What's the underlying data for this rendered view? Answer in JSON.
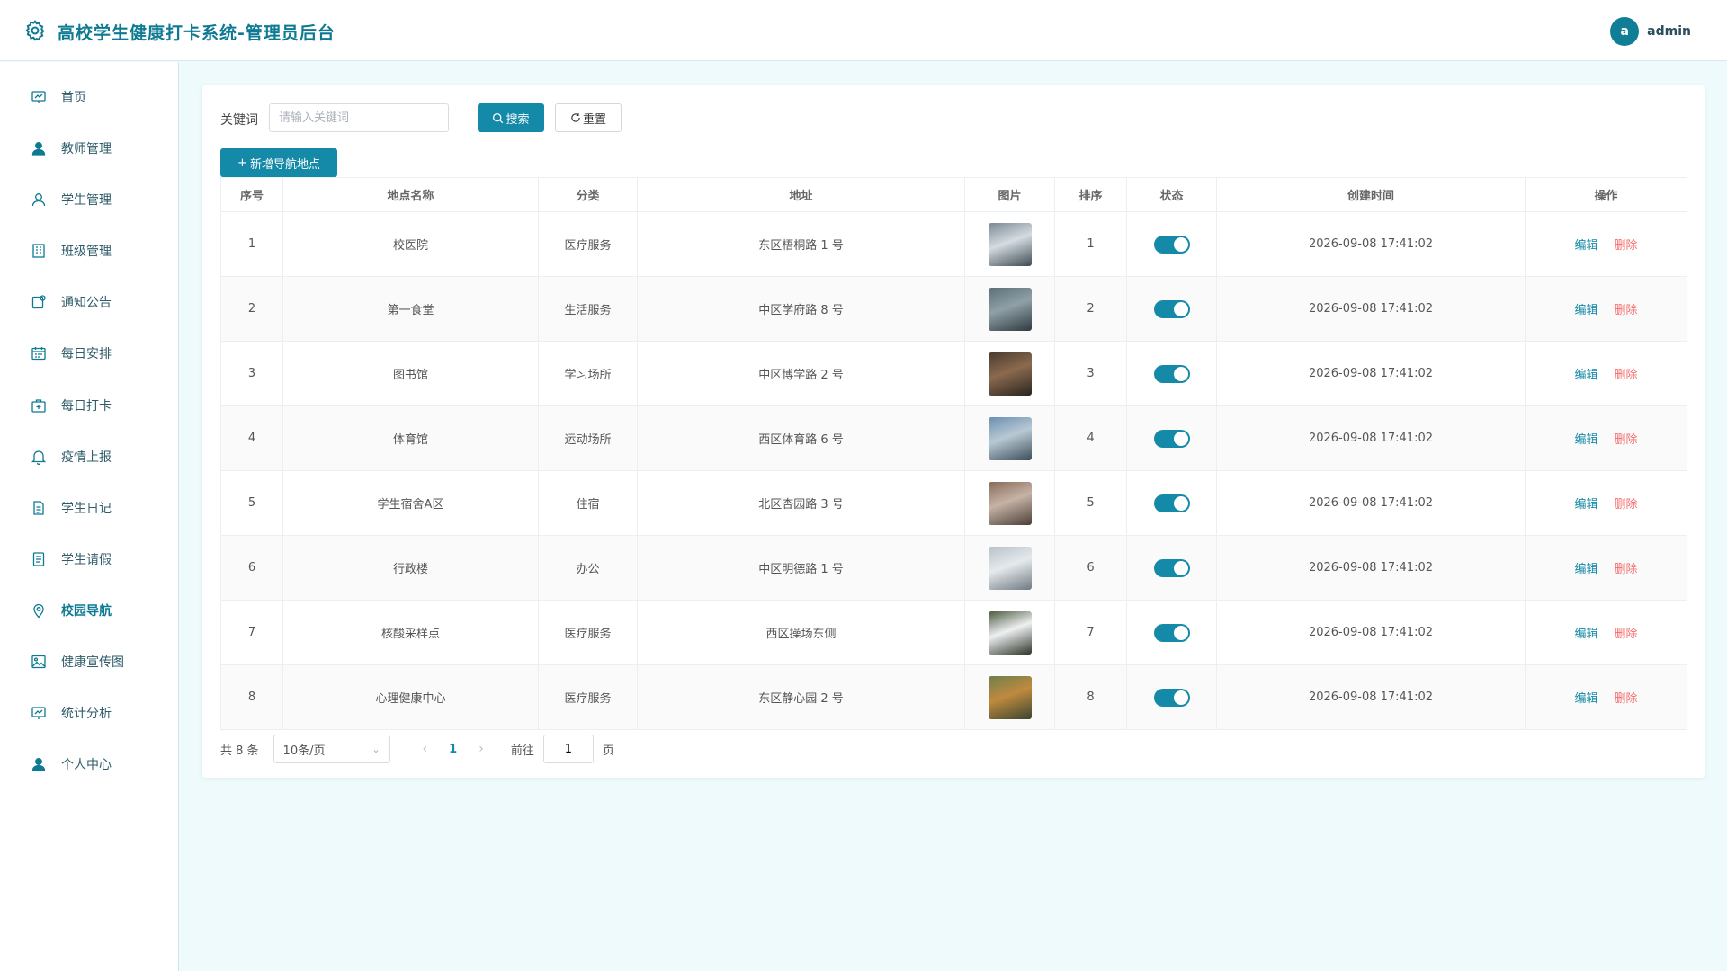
{
  "header": {
    "title": "高校学生健康打卡系统-管理员后台",
    "avatar_letter": "a",
    "username": "admin",
    "accent": "#0d7a92"
  },
  "sidebar": {
    "active": "校园导航",
    "items": [
      {
        "label": "首页",
        "icon": "chart-board-icon"
      },
      {
        "label": "教师管理",
        "icon": "user-filled-icon"
      },
      {
        "label": "学生管理",
        "icon": "user-outline-icon"
      },
      {
        "label": "班级管理",
        "icon": "building-icon"
      },
      {
        "label": "通知公告",
        "icon": "notice-icon"
      },
      {
        "label": "每日安排",
        "icon": "calendar-icon"
      },
      {
        "label": "每日打卡",
        "icon": "medical-box-icon"
      },
      {
        "label": "疫情上报",
        "icon": "bell-icon"
      },
      {
        "label": "学生日记",
        "icon": "document-icon"
      },
      {
        "label": "学生请假",
        "icon": "document-list-icon"
      },
      {
        "label": "校园导航",
        "icon": "location-icon"
      },
      {
        "label": "健康宣传图",
        "icon": "picture-icon"
      },
      {
        "label": "统计分析",
        "icon": "chart-board-icon"
      },
      {
        "label": "个人中心",
        "icon": "user-filled-icon"
      }
    ]
  },
  "search": {
    "label": "关键词",
    "placeholder": "请输入关键词",
    "value": "",
    "search_btn": "搜索",
    "reset_btn": "重置",
    "add_btn": "新增导航地点"
  },
  "table": {
    "headers": [
      "序号",
      "地点名称",
      "分类",
      "地址",
      "图片",
      "排序",
      "状态",
      "创建时间",
      "操作"
    ],
    "edit_label": "编辑",
    "delete_label": "删除",
    "rows": [
      {
        "no": "1",
        "name": "校医院",
        "category": "医疗服务",
        "address": "东区梧桐路 1 号",
        "sort": "1",
        "status": true,
        "created": "2026-09-08 17:41:02",
        "thumb": [
          "#7a8894",
          "#d5dce2",
          "#3e4a52"
        ]
      },
      {
        "no": "2",
        "name": "第一食堂",
        "category": "生活服务",
        "address": "中区学府路 8 号",
        "sort": "2",
        "status": true,
        "created": "2026-09-08 17:41:02",
        "thumb": [
          "#5c6f78",
          "#8fa0a6",
          "#2f3b40"
        ]
      },
      {
        "no": "3",
        "name": "图书馆",
        "category": "学习场所",
        "address": "中区博学路 2 号",
        "sort": "3",
        "status": true,
        "created": "2026-09-08 17:41:02",
        "thumb": [
          "#4a3a30",
          "#8b6a4e",
          "#2a2520"
        ]
      },
      {
        "no": "4",
        "name": "体育馆",
        "category": "运动场所",
        "address": "西区体育路 6 号",
        "sort": "4",
        "status": true,
        "created": "2026-09-08 17:41:02",
        "thumb": [
          "#6a8fb0",
          "#b9c9d4",
          "#3b4e5a"
        ]
      },
      {
        "no": "5",
        "name": "学生宿舍A区",
        "category": "住宿",
        "address": "北区杏园路 3 号",
        "sort": "5",
        "status": true,
        "created": "2026-09-08 17:41:02",
        "thumb": [
          "#8a6a5a",
          "#c5b3a6",
          "#4d3e36"
        ]
      },
      {
        "no": "6",
        "name": "行政楼",
        "category": "办公",
        "address": "中区明德路 1 号",
        "sort": "6",
        "status": true,
        "created": "2026-09-08 17:41:02",
        "thumb": [
          "#b8c2c8",
          "#e5e9ec",
          "#6f7b82"
        ]
      },
      {
        "no": "7",
        "name": "核酸采样点",
        "category": "医疗服务",
        "address": "西区操场东侧",
        "sort": "7",
        "status": true,
        "created": "2026-09-08 17:41:02",
        "thumb": [
          "#4c5a3e",
          "#eef0f2",
          "#2e3528"
        ]
      },
      {
        "no": "8",
        "name": "心理健康中心",
        "category": "医疗服务",
        "address": "东区静心园 2 号",
        "sort": "8",
        "status": true,
        "created": "2026-09-08 17:41:02",
        "thumb": [
          "#6d7f4e",
          "#c08a3e",
          "#3a4530"
        ]
      }
    ]
  },
  "pager": {
    "total": "共 8 条",
    "page_size": "10条/页",
    "current": "1",
    "goto_label": "前往",
    "goto_value": "1",
    "page_unit": "页"
  }
}
